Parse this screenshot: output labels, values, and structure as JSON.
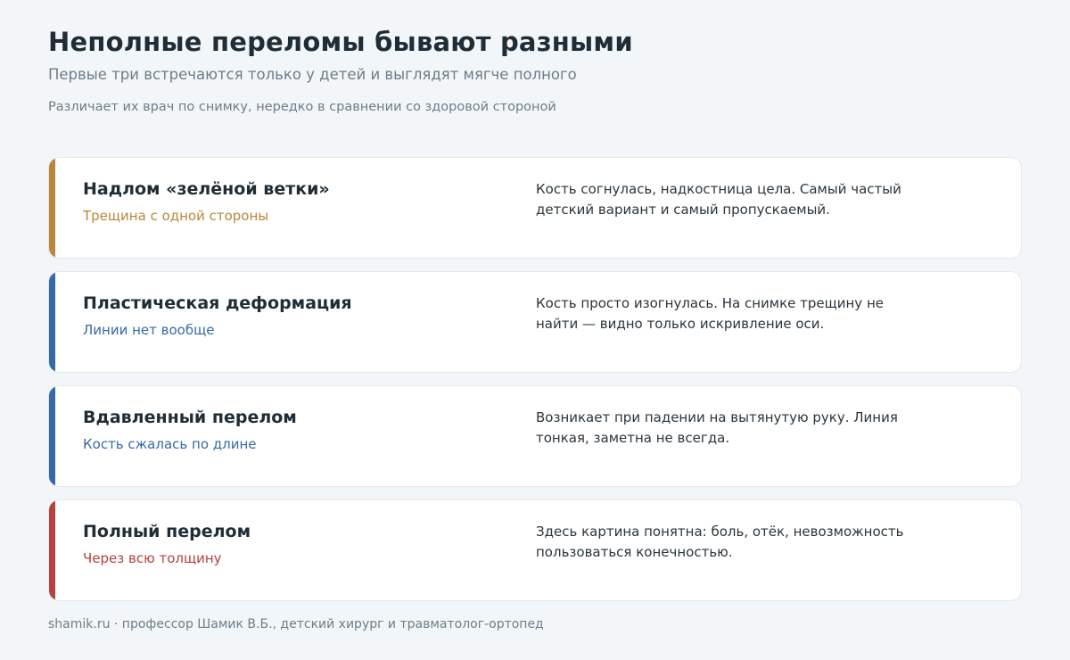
{
  "header": {
    "title": "Неполные переломы бывают разными",
    "subtitle": "Первые три встречаются только у детей и выглядят мягче полного",
    "note": "Различает их врач по снимку, нередко в сравнении со здоровой стороной"
  },
  "cards": [
    {
      "name": "Надлом «зелёной ветки»",
      "tag": "Трещина с одной стороны",
      "desc": "Кость согнулась, надкостница цела. Самый частый детский вариант и самый пропускаемый.",
      "color": "#b8873a"
    },
    {
      "name": "Пластическая деформация",
      "tag": "Линии нет вообще",
      "desc": "Кость просто изогнулась. На снимке трещину не найти — видно только искривление оси.",
      "color": "#3569a8"
    },
    {
      "name": "Вдавленный перелом",
      "tag": "Кость сжалась по длине",
      "desc": "Возникает при падении на вытянутую руку. Линия тонкая, заметна не всегда.",
      "color": "#3569a8"
    },
    {
      "name": "Полный перелом",
      "tag": "Через всю толщину",
      "desc": "Здесь картина понятна: боль, отёк, невозможность пользоваться конечностью.",
      "color": "#b5423f"
    }
  ],
  "footer": {
    "text": "shamik.ru · профессор Шамик В.Б., детский хирург и травматолог-ортопед"
  }
}
